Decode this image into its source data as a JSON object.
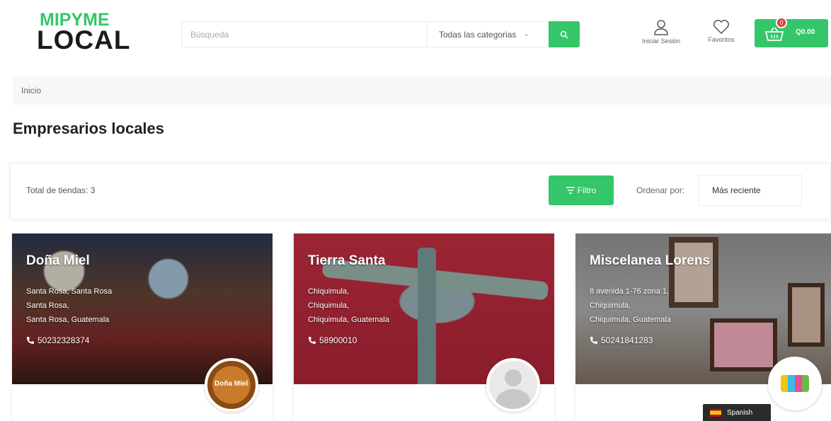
{
  "header": {
    "logo_line1": "MIPYME",
    "logo_line2": "LOCAL",
    "search_placeholder": "Búsqueda",
    "category_select": "Todas las categorias",
    "login_label": "Iniciar Sesión",
    "favorites_label": "Favoritos",
    "cart_count": "0",
    "cart_total": "Q0.00",
    "colors": {
      "accent": "#35c66a",
      "badge": "#e53935"
    }
  },
  "breadcrumb": {
    "home": "Inicio"
  },
  "page": {
    "title": "Empresarios locales"
  },
  "toolbar": {
    "total_label": "Total de tiendas: 3",
    "filter_label": "Filtro",
    "sort_label": "Ordenar por:",
    "sort_value": "Más reciente"
  },
  "stores": [
    {
      "name": "Doña Miel",
      "address_lines": [
        "Santa Rosa, Santa Rosa",
        "Santa Rosa,",
        "Santa Rosa, Guatemala"
      ],
      "phone": "50232328374",
      "avatar_text": "Doña Miel"
    },
    {
      "name": "Tierra Santa",
      "address_lines": [
        "Chiquimula,",
        "Chiquimula,",
        "Chiquimula, Guatemala"
      ],
      "phone": "58900010"
    },
    {
      "name": "Miscelanea Lorens",
      "address_lines": [
        "8 avenida 1-76 zona 1,",
        "Chiquimula,",
        "Chiquimula, Guatemala"
      ],
      "phone": "50241841283"
    }
  ],
  "language": {
    "label": "Spanish"
  }
}
